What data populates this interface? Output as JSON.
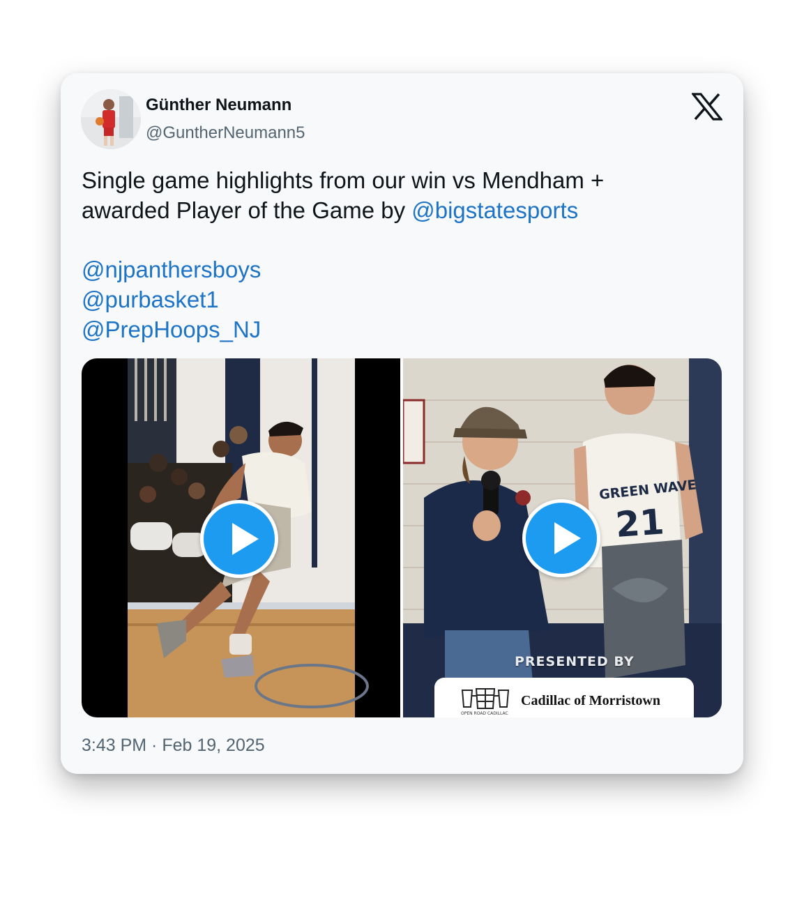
{
  "author": {
    "name": "Günther Neumann",
    "handle": "@GuntherNeumann5",
    "avatar_icon": "avatar-photo"
  },
  "platform_icon": "x-logo-icon",
  "tweet": {
    "line1": "Single game highlights from our win vs Mendham +",
    "line2_text": "awarded Player of the Game by ",
    "line2_mention": "@bigstatesports",
    "mentions": [
      "@njpanthersboys",
      "@purbasket1",
      "@PrepHoops_NJ"
    ]
  },
  "media": {
    "video1": {
      "icon": "play-icon"
    },
    "video2": {
      "icon": "play-icon",
      "jersey_text": "GREEN WAVE",
      "jersey_number": "21",
      "presented_by": "PRESENTED BY",
      "sponsor_name": "Cadillac of Morristown",
      "sponsor_subtext": "OPEN ROAD CADILLAC"
    }
  },
  "timestamp": "3:43 PM · Feb 19, 2025",
  "colors": {
    "link": "#1d74c7",
    "play_button": "#1d9bf0",
    "card_bg": "#f7f9fb"
  }
}
